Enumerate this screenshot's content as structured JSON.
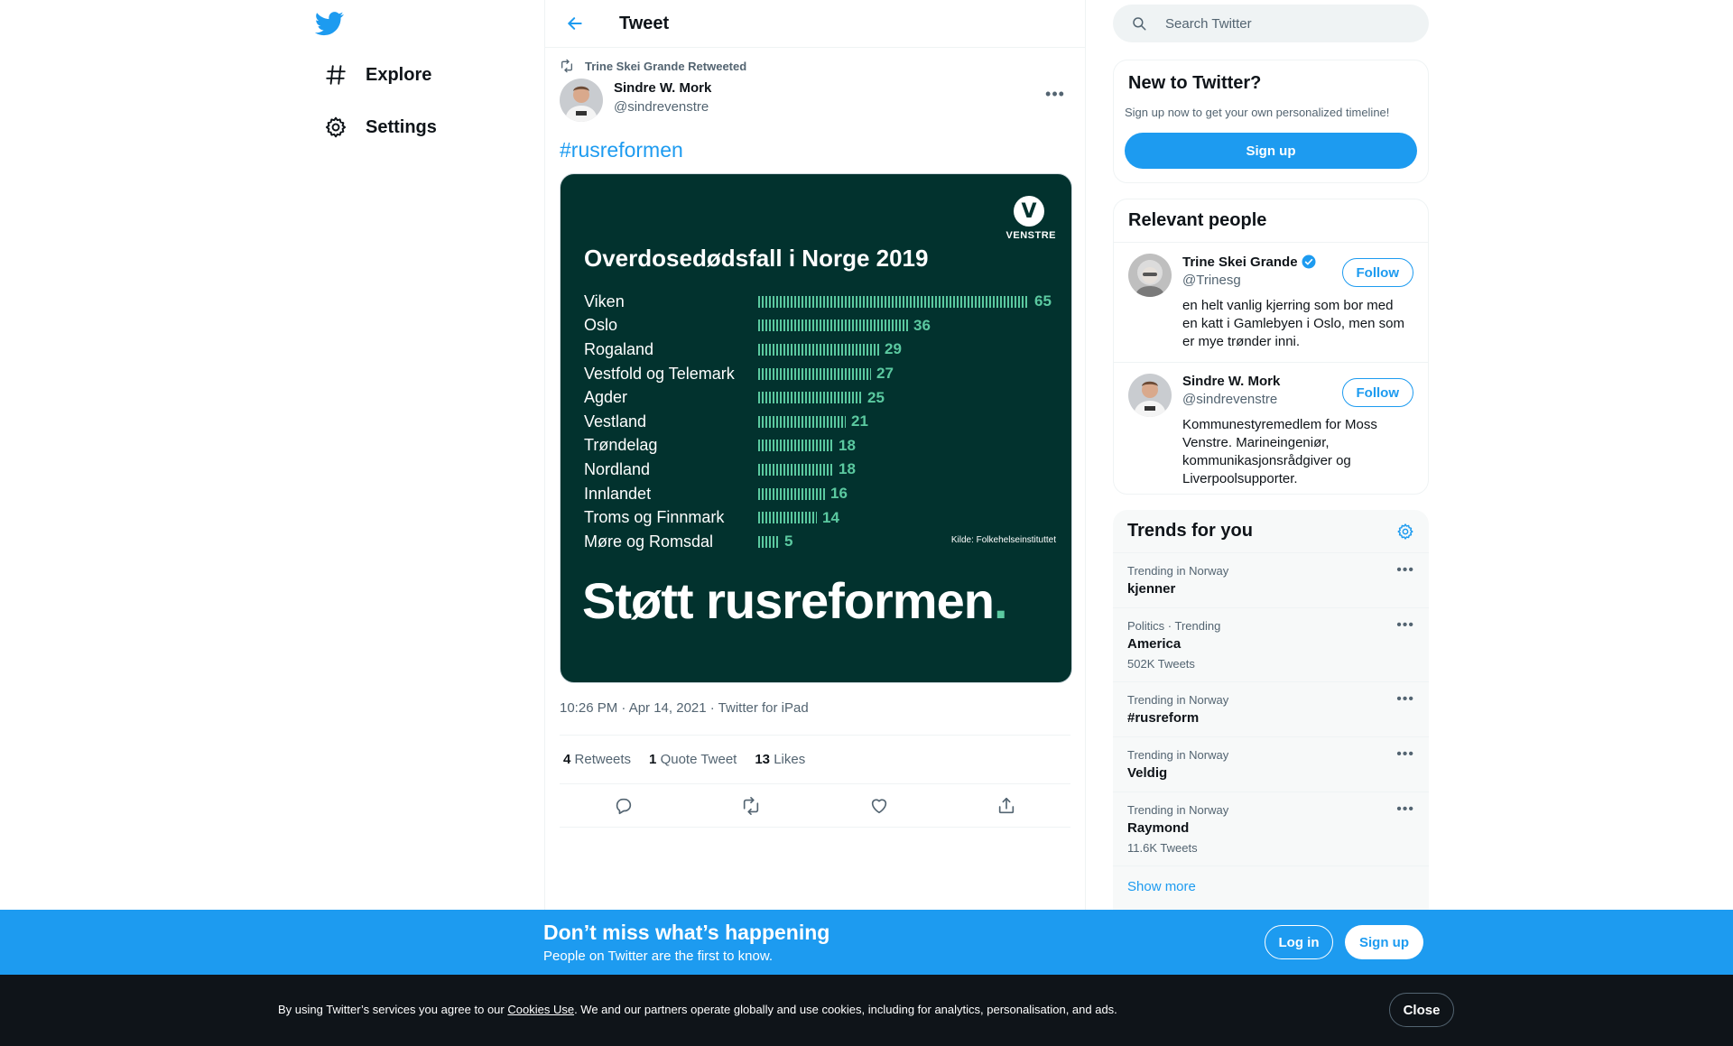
{
  "nav": {
    "items": [
      {
        "label": "Explore",
        "icon": "hashtag-icon"
      },
      {
        "label": "Settings",
        "icon": "gear-icon"
      }
    ]
  },
  "header": {
    "title": "Tweet"
  },
  "tweet": {
    "retweet_text": "Trine Skei Grande Retweeted",
    "author_name": "Sindre W. Mork",
    "author_handle": "@sindrevenstre",
    "hashtag": "#rusreformen",
    "meta": "10:26 PM · Apr 14, 2021 · Twitter for iPad",
    "stats": {
      "retweets_count": "4",
      "retweets_label": "Retweets",
      "quotes_count": "1",
      "quotes_label": "Quote Tweet",
      "likes_count": "13",
      "likes_label": "Likes"
    },
    "media": {
      "logo_text": "VENSTRE",
      "title": "Overdosedødsfall i Norge 2019",
      "source": "Kilde: Folkehelseinstituttet",
      "slogan": "Støtt rusreformen",
      "slogan_dot": ".",
      "accent_color": "#5bc9a0",
      "background_color": "#02322e"
    }
  },
  "chart_data": {
    "type": "bar",
    "title": "Overdosedødsfall i Norge 2019",
    "categories": [
      "Viken",
      "Oslo",
      "Rogaland",
      "Vestfold og Telemark",
      "Agder",
      "Vestland",
      "Trøndelag",
      "Nordland",
      "Innlandet",
      "Troms og Finnmark",
      "Møre og Romsdal"
    ],
    "values": [
      65,
      36,
      29,
      27,
      25,
      21,
      18,
      18,
      16,
      14,
      5
    ]
  },
  "search": {
    "placeholder": "Search Twitter"
  },
  "new_to_twitter": {
    "title": "New to Twitter?",
    "subtitle": "Sign up now to get your own personalized timeline!",
    "button": "Sign up"
  },
  "relevant_people": {
    "title": "Relevant people",
    "people": [
      {
        "name": "Trine Skei Grande",
        "handle": "@Trinesg",
        "bio": "en helt vanlig kjerring som bor med en katt i Gamlebyen i Oslo, men som er mye trønder inni.",
        "follow": "Follow",
        "verified": true
      },
      {
        "name": "Sindre W. Mork",
        "handle": "@sindrevenstre",
        "bio": "Kommunestyremedlem for Moss Venstre. Marineingeniør, kommunikasjonsrådgiver og Liverpoolsupporter.",
        "follow": "Follow",
        "verified": false
      }
    ]
  },
  "trends": {
    "title": "Trends for you",
    "items": [
      {
        "context": "Trending in Norway",
        "name": "kjenner",
        "count": ""
      },
      {
        "context": "Politics · Trending",
        "name": "America",
        "count": "502K Tweets"
      },
      {
        "context": "Trending in Norway",
        "name": "#rusreform",
        "count": ""
      },
      {
        "context": "Trending in Norway",
        "name": "Veldig",
        "count": ""
      },
      {
        "context": "Trending in Norway",
        "name": "Raymond",
        "count": "11.6K Tweets"
      }
    ],
    "show_more": "Show more"
  },
  "bottom_bar": {
    "title": "Don’t miss what’s happening",
    "subtitle": "People on Twitter are the first to know.",
    "login": "Log in",
    "signup": "Sign up"
  },
  "cookie": {
    "text_before": "By using Twitter’s services you agree to our ",
    "link": "Cookies Use",
    "text_after": ". We and our partners operate globally and use cookies, including for analytics, personalisation, and ads.",
    "close": "Close"
  },
  "colors": {
    "accent": "#1d9bf0",
    "text": "#0f1419",
    "secondary": "#536471"
  }
}
